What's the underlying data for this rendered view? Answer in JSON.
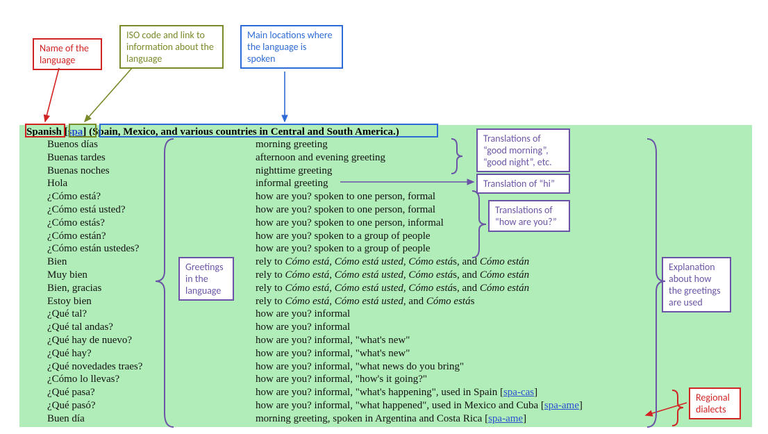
{
  "header": {
    "language_name": "Spanish",
    "iso_code": "spa",
    "locations": "Spain, Mexico, and various countries in Central and South America."
  },
  "rows": [
    {
      "greeting": "Buenos días",
      "desc": [
        {
          "t": "morning greeting"
        }
      ]
    },
    {
      "greeting": "Buenas tardes",
      "desc": [
        {
          "t": "afternoon and evening greeting"
        }
      ]
    },
    {
      "greeting": "Buenas noches",
      "desc": [
        {
          "t": "nighttime greeting"
        }
      ]
    },
    {
      "greeting": "Hola",
      "desc": [
        {
          "t": "informal greeting"
        }
      ]
    },
    {
      "greeting": "¿Cómo está?",
      "desc": [
        {
          "t": "how are you? spoken to one person, formal"
        }
      ]
    },
    {
      "greeting": "¿Cómo está usted?",
      "desc": [
        {
          "t": "how are you? spoken to one person, formal"
        }
      ]
    },
    {
      "greeting": "¿Cómo estás?",
      "desc": [
        {
          "t": "how are you? spoken to one person, informal"
        }
      ]
    },
    {
      "greeting": "¿Cómo están?",
      "desc": [
        {
          "t": "how are you? spoken to a group of people"
        }
      ]
    },
    {
      "greeting": "¿Cómo están ustedes?",
      "desc": [
        {
          "t": "how are you? spoken to a group of people"
        }
      ]
    },
    {
      "greeting": "Bien",
      "desc": [
        {
          "t": "rely to "
        },
        {
          "i": "Cómo está"
        },
        {
          "t": ", "
        },
        {
          "i": "Cómo está usted"
        },
        {
          "t": ", "
        },
        {
          "i": "Cómo está"
        },
        {
          "t": "s, and "
        },
        {
          "i": "Cómo están"
        }
      ]
    },
    {
      "greeting": "Muy bien",
      "desc": [
        {
          "t": "rely to "
        },
        {
          "i": "Cómo está"
        },
        {
          "t": ", "
        },
        {
          "i": "Cómo está usted"
        },
        {
          "t": ", "
        },
        {
          "i": "Cómo está"
        },
        {
          "t": "s, and "
        },
        {
          "i": "Cómo están"
        }
      ]
    },
    {
      "greeting": "Bien, gracias",
      "desc": [
        {
          "t": "rely to "
        },
        {
          "i": "Cómo está"
        },
        {
          "t": ", "
        },
        {
          "i": "Cómo está usted"
        },
        {
          "t": ", "
        },
        {
          "i": "Cómo está"
        },
        {
          "t": "s, and "
        },
        {
          "i": "Cómo están"
        }
      ]
    },
    {
      "greeting": "Estoy bien",
      "desc": [
        {
          "t": "rely to "
        },
        {
          "i": "Cómo está"
        },
        {
          "t": ", "
        },
        {
          "i": "Cómo está usted"
        },
        {
          "t": ", and "
        },
        {
          "i": "Cómo está"
        },
        {
          "t": "s"
        }
      ]
    },
    {
      "greeting": "¿Qué tal?",
      "desc": [
        {
          "t": "how are you? informal"
        }
      ]
    },
    {
      "greeting": "¿Qué tal andas?",
      "desc": [
        {
          "t": "how are you? informal"
        }
      ]
    },
    {
      "greeting": "¿Qué hay de nuevo?",
      "desc": [
        {
          "t": "how are you? informal, \"what's new\""
        }
      ]
    },
    {
      "greeting": "¿Qué hay?",
      "desc": [
        {
          "t": "how are you? informal, \"what's new\""
        }
      ]
    },
    {
      "greeting": "¿Qué novedades traes?",
      "desc": [
        {
          "t": "how are you? informal, \"what news do you bring\""
        }
      ]
    },
    {
      "greeting": "¿Cómo lo llevas?",
      "desc": [
        {
          "t": "how are you? informal, \"how's it going?\""
        }
      ]
    },
    {
      "greeting": "¿Qué pasa?",
      "desc": [
        {
          "t": "how are you? informal, \"what's happening\", used in Spain ["
        },
        {
          "a": "spa-cas"
        },
        {
          "t": "]"
        }
      ]
    },
    {
      "greeting": "¿Qué pasó?",
      "desc": [
        {
          "t": "how are you? informal, \"what happened\", used in Mexico and Cuba ["
        },
        {
          "a": "spa-ame"
        },
        {
          "t": "]"
        }
      ]
    },
    {
      "greeting": "Buen día",
      "desc": [
        {
          "t": "morning greeting, spoken in Argentina and Costa Rica ["
        },
        {
          "a": "spa-ame"
        },
        {
          "t": "]"
        }
      ]
    }
  ],
  "callouts": {
    "name": "Name of the language",
    "iso": "ISO code and link to information about the language",
    "locations": "Main locations where the language is spoken",
    "good": "Translations of “good morning”, “good night”, etc.",
    "hi": "Translation of “hi”",
    "how": "Translations of “how are you?”",
    "greetings": "Greetings in the language",
    "explain": "Explanation about how the greetings are used",
    "dialects": "Regional dialects"
  }
}
